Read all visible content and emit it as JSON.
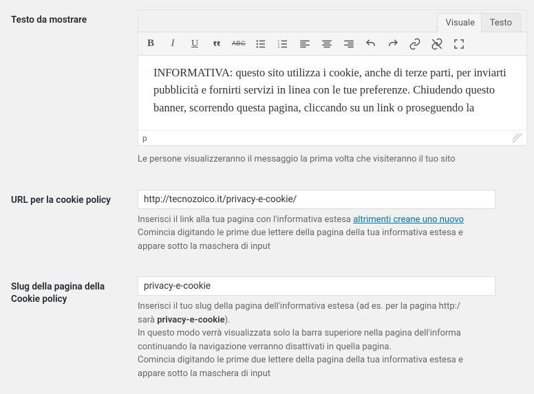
{
  "labels": {
    "testo_da_mostrare": "Testo da mostrare",
    "url_cookie_policy": "URL per la cookie policy",
    "slug_cookie_policy": "Slug della pagina della Cookie policy"
  },
  "tabs": {
    "visuale": "Visuale",
    "testo": "Testo"
  },
  "editor": {
    "content": "INFORMATIVA: questo sito utilizza i cookie, anche di terze parti, per inviarti pubblicità e fornirti servizi in linea con le tue preferenze. Chiudendo questo banner, scorrendo questa pagina, cliccando su un link o proseguendo la",
    "status_path": "p"
  },
  "descriptions": {
    "testo_after": "Le persone visualizzeranno il messaggio la prima volta che visiteranno il tuo sito",
    "url_help_1": "Inserisci il link alla tua pagina con l'informativa estesa ",
    "url_link": "altrimenti creane uno nuovo",
    "url_help_2": "Comincia digitando le prime due lettere della pagina della tua informativa estesa e",
    "url_help_3": "appare sotto la maschera di input",
    "slug_help_1a": "Inserisci il tuo slug della pagina dell'informativa estesa (ad es. per la pagina http:/",
    "slug_help_1b_pre": "sarà ",
    "slug_bold": "privacy-e-cookie",
    "slug_help_1b_post": ").",
    "slug_help_2": "In questo modo verrà visualizzata solo la barra superiore nella pagina dell'informa",
    "slug_help_3": "continuando la navigazione verranno disattivati in quella pagina.",
    "slug_help_4": "Comincia digitando le prime due lettere della pagina della tua informativa estesa e",
    "slug_help_5": "appare sotto la maschera di input"
  },
  "inputs": {
    "url_value": "http://tecnozoico.it/privacy-e-cookie/",
    "slug_value": "privacy-e-cookie"
  },
  "toolbar": {
    "strike_label": "ABC"
  }
}
